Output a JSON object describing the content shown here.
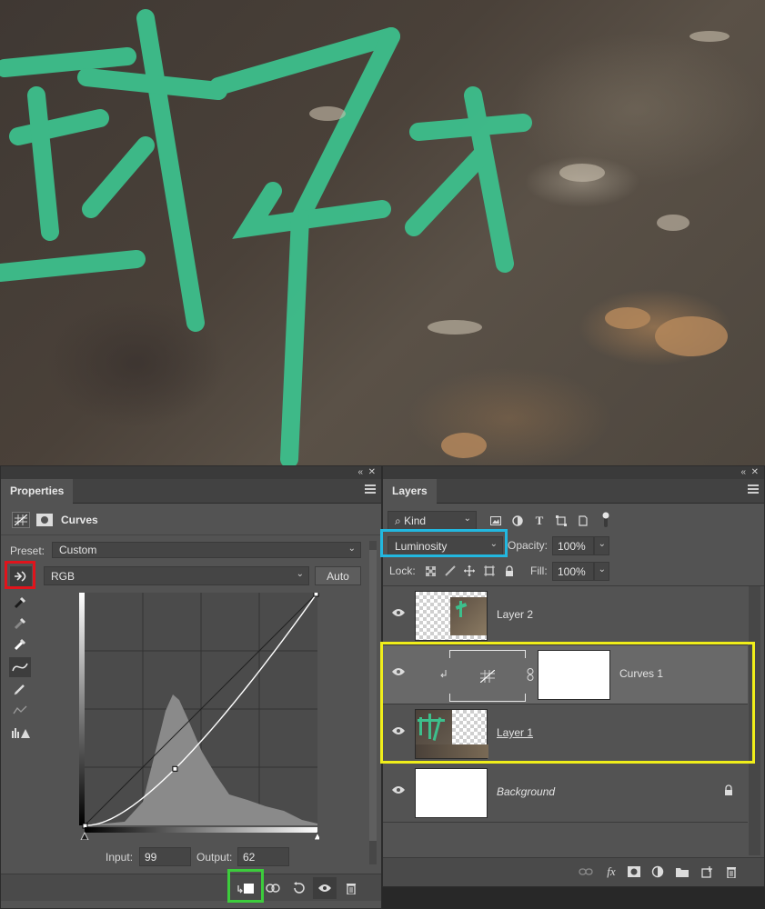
{
  "properties": {
    "tab": "Properties",
    "adjustment_title": "Curves",
    "preset_label": "Preset:",
    "preset_value": "Custom",
    "channel_value": "RGB",
    "auto_label": "Auto",
    "input_label": "Input:",
    "input_value": "99",
    "output_label": "Output:",
    "output_value": "62",
    "curve_point": {
      "input": 99,
      "output": 62
    }
  },
  "layers": {
    "tab": "Layers",
    "filter_kind": "Kind",
    "blend_mode": "Luminosity",
    "opacity_label": "Opacity:",
    "opacity_value": "100%",
    "lock_label": "Lock:",
    "fill_label": "Fill:",
    "fill_value": "100%",
    "items": [
      {
        "name": "Layer 2"
      },
      {
        "name": "Curves 1"
      },
      {
        "name": "Layer 1"
      },
      {
        "name": "Background"
      }
    ]
  },
  "colors": {
    "red_highlight": "#e0141c",
    "cyan_highlight": "#22b8e0",
    "yellow_highlight": "#f0ee1a",
    "green_highlight": "#3ccc3c",
    "graffiti": "#3dbf8c"
  }
}
